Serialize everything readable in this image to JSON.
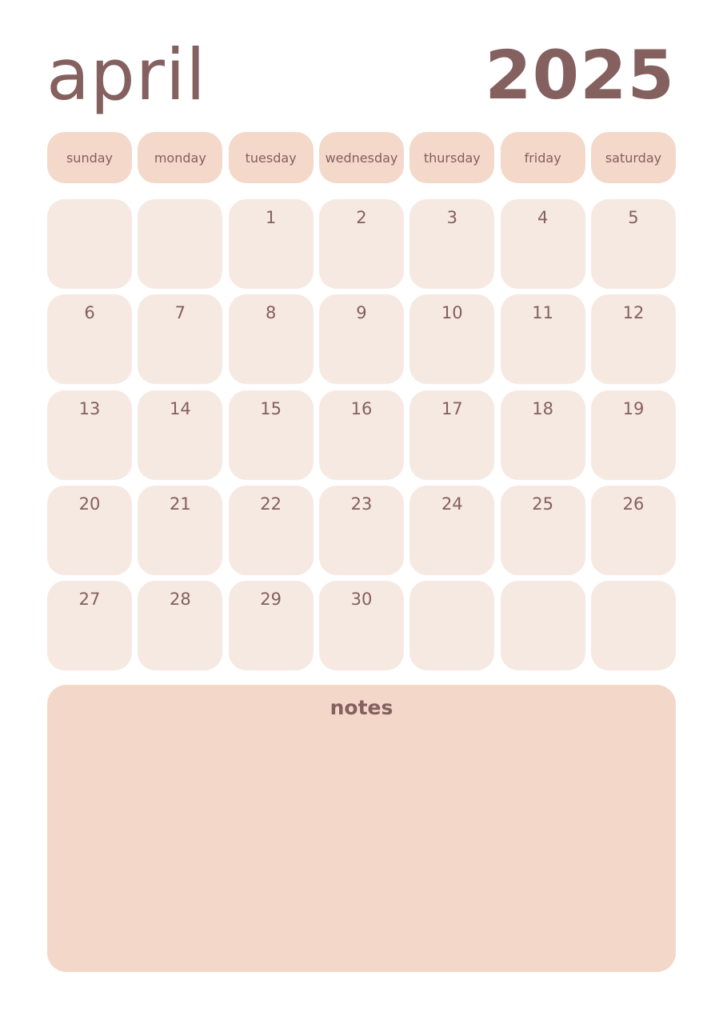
{
  "header": {
    "month": "april",
    "year": "2025"
  },
  "weekdays": [
    "sunday",
    "monday",
    "tuesday",
    "wednesday",
    "thursday",
    "friday",
    "saturday"
  ],
  "weeks": [
    [
      "",
      "",
      "1",
      "2",
      "3",
      "4",
      "5"
    ],
    [
      "6",
      "7",
      "8",
      "9",
      "10",
      "11",
      "12"
    ],
    [
      "13",
      "14",
      "15",
      "16",
      "17",
      "18",
      "19"
    ],
    [
      "20",
      "21",
      "22",
      "23",
      "24",
      "25",
      "26"
    ],
    [
      "27",
      "28",
      "29",
      "30",
      "",
      "",
      ""
    ]
  ],
  "notes": {
    "title": "notes"
  },
  "colors": {
    "text": "#84605f",
    "weekday_bg": "#f4d8c9",
    "day_bg": "#f6e9e2",
    "notes_bg": "#f3d8c9"
  }
}
